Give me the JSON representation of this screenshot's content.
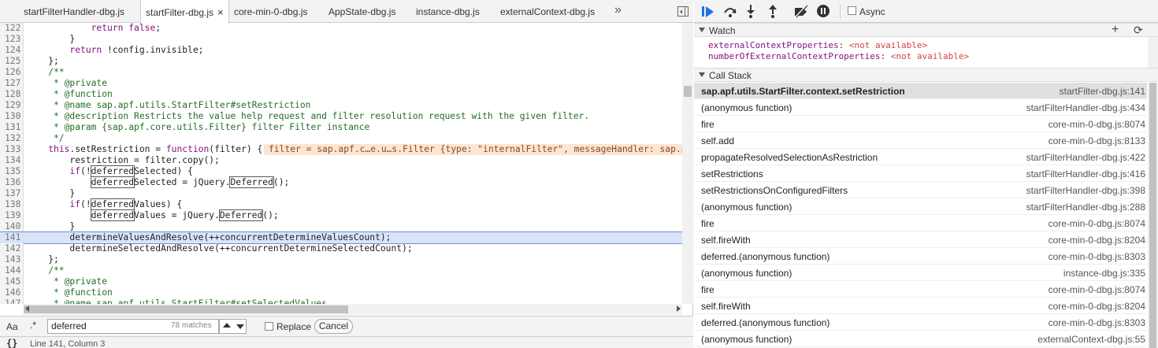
{
  "tabs": [
    {
      "label": "startFilterHandler-dbg.js",
      "active": false
    },
    {
      "label": "startFilter-dbg.js",
      "active": true,
      "close_glyph": "×"
    },
    {
      "label": "core-min-0-dbg.js",
      "active": false
    },
    {
      "label": "AppState-dbg.js",
      "active": false
    },
    {
      "label": "instance-dbg.js",
      "active": false
    },
    {
      "label": "externalContext-dbg.js",
      "active": false
    }
  ],
  "tab_more_glyph": "»",
  "code": {
    "current_line": "141",
    "inline_value": "filter = sap.apf.c…e.u…s.Filter {type: \"internalFilter\", messageHandler: sap.apf",
    "lines": [
      {
        "n": "122",
        "t": "            return false;"
      },
      {
        "n": "123",
        "t": "        }"
      },
      {
        "n": "124",
        "t": "        return !config.invisible;"
      },
      {
        "n": "125",
        "t": "    };"
      },
      {
        "n": "126",
        "t": "    /**"
      },
      {
        "n": "127",
        "t": "     * @private"
      },
      {
        "n": "128",
        "t": "     * @function"
      },
      {
        "n": "129",
        "t": "     * @name sap.apf.utils.StartFilter#setRestriction"
      },
      {
        "n": "130",
        "t": "     * @description Restricts the value help request and filter resolution request with the given filter."
      },
      {
        "n": "131",
        "t": "     * @param {sap.apf.core.utils.Filter} filter Filter instance"
      },
      {
        "n": "132",
        "t": "     */"
      },
      {
        "n": "133",
        "t": "    this.setRestriction = function(filter) {"
      },
      {
        "n": "134",
        "t": "        restriction = filter.copy();"
      },
      {
        "n": "135",
        "t": "        if(!deferredSelected) {"
      },
      {
        "n": "136",
        "t": "            deferredSelected = jQuery.Deferred();"
      },
      {
        "n": "137",
        "t": "        }"
      },
      {
        "n": "138",
        "t": "        if(!deferredValues) {"
      },
      {
        "n": "139",
        "t": "            deferredValues = jQuery.Deferred();"
      },
      {
        "n": "140",
        "t": "        }"
      },
      {
        "n": "141",
        "t": "        determineValuesAndResolve(++concurrentDetermineValuesCount);"
      },
      {
        "n": "142",
        "t": "        determineSelectedAndResolve(++concurrentDetermineSelectedCount);"
      },
      {
        "n": "143",
        "t": "    };"
      },
      {
        "n": "144",
        "t": "    /**"
      },
      {
        "n": "145",
        "t": "     * @private"
      },
      {
        "n": "146",
        "t": "     * @function"
      },
      {
        "n": "147",
        "t": "     * @name sap.apf.utils.StartFilter#setSelectedValues"
      }
    ]
  },
  "search": {
    "case_label": "Aa",
    "regex_label": ".*",
    "query": "deferred",
    "count": "78 matches",
    "replace_label": "Replace",
    "cancel_label": "Cancel"
  },
  "status": {
    "pretty_label": "{}",
    "position": "Line 141, Column 3"
  },
  "debugger": {
    "async_label": "Async",
    "watch": {
      "title": "Watch",
      "add_glyph": "+",
      "refresh_glyph": "⟳",
      "items": [
        {
          "name": "externalContextProperties",
          "value": "<not available>"
        },
        {
          "name": "numberOfExternalContextProperties",
          "value": "<not available>"
        }
      ]
    },
    "call_stack": {
      "title": "Call Stack",
      "frames": [
        {
          "fn": "sap.apf.utils.StartFilter.context.setRestriction",
          "loc": "startFilter-dbg.js:141",
          "selected": true
        },
        {
          "fn": "(anonymous function)",
          "loc": "startFilterHandler-dbg.js:434"
        },
        {
          "fn": "fire",
          "loc": "core-min-0-dbg.js:8074"
        },
        {
          "fn": "self.add",
          "loc": "core-min-0-dbg.js:8133"
        },
        {
          "fn": "propagateResolvedSelectionAsRestriction",
          "loc": "startFilterHandler-dbg.js:422"
        },
        {
          "fn": "setRestrictions",
          "loc": "startFilterHandler-dbg.js:416"
        },
        {
          "fn": "setRestrictionsOnConfiguredFilters",
          "loc": "startFilterHandler-dbg.js:398"
        },
        {
          "fn": "(anonymous function)",
          "loc": "startFilterHandler-dbg.js:288"
        },
        {
          "fn": "fire",
          "loc": "core-min-0-dbg.js:8074"
        },
        {
          "fn": "self.fireWith",
          "loc": "core-min-0-dbg.js:8204"
        },
        {
          "fn": "deferred.(anonymous function)",
          "loc": "core-min-0-dbg.js:8303"
        },
        {
          "fn": "(anonymous function)",
          "loc": "instance-dbg.js:335"
        },
        {
          "fn": "fire",
          "loc": "core-min-0-dbg.js:8074"
        },
        {
          "fn": "self.fireWith",
          "loc": "core-min-0-dbg.js:8204"
        },
        {
          "fn": "deferred.(anonymous function)",
          "loc": "core-min-0-dbg.js:8303"
        },
        {
          "fn": "(anonymous function)",
          "loc": "externalContext-dbg.js:55"
        }
      ]
    }
  },
  "colors": {
    "accent": "#1a73e8",
    "current_line_bg": "#d9e4fb",
    "selected_frame_bg": "#e0e0e0",
    "inline_value_bg": "#fce5d2"
  }
}
